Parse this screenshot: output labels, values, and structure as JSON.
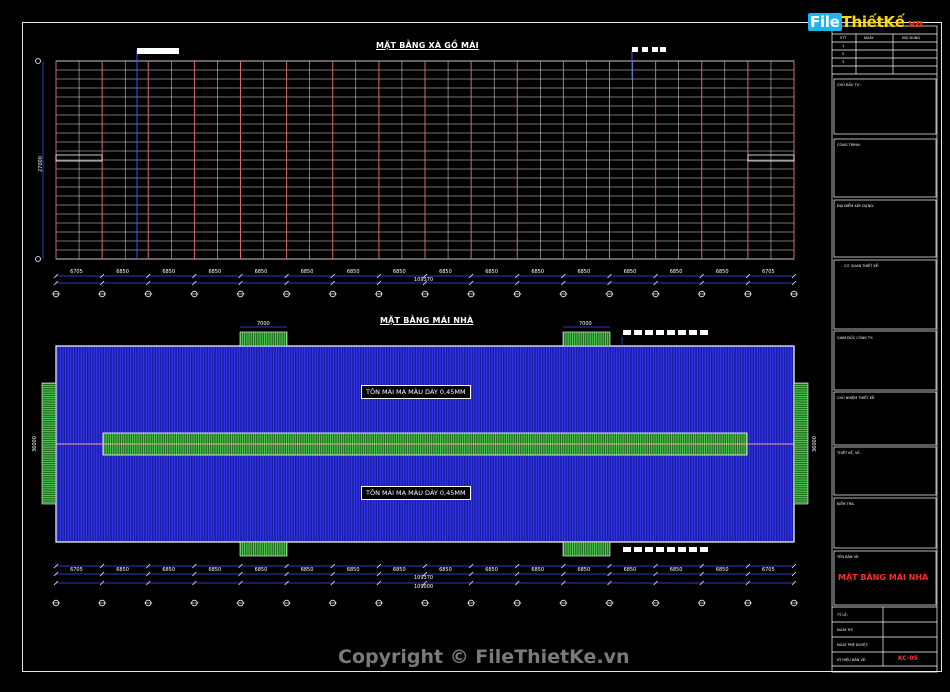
{
  "drawing": {
    "title_top": "MẶT BẰNG XÀ GỒ MÁI",
    "title_bottom": "MẶT BẰNG MÁI NHÀ",
    "roof_note_1": "TÔN MÁI MẠ MÀU DÀY 0,45MM",
    "roof_note_2": "TÔN MÁI MẠ MÀU DÀY 0,45MM",
    "top_span_labels": [
      "6705",
      "6850",
      "6850",
      "6850",
      "6850",
      "6850",
      "6850",
      "6850",
      "6850",
      "6850",
      "6850",
      "6850",
      "6850",
      "6850",
      "6850",
      "6705"
    ],
    "top_total": "109370",
    "bottom_span_labels": [
      "6705",
      "6850",
      "6850",
      "6850",
      "6850",
      "6850",
      "6850",
      "6850",
      "6850",
      "6850",
      "6850",
      "6850",
      "6850",
      "6850",
      "6850",
      "6705"
    ],
    "bottom_total_1": "109370",
    "bottom_total_2": "109000",
    "top_height_label": "27000",
    "bottom_height_left": "36000",
    "bottom_height_right": "36000",
    "skylight_dim_1": "7000",
    "skylight_dim_2": "7000"
  },
  "title_block": {
    "rows_header": [
      "STT",
      "NGÀY",
      "NỘI DUNG"
    ],
    "rows": [
      "1",
      "2",
      "3"
    ],
    "sections": [
      "CHỦ ĐẦU TƯ:",
      "CÔNG TRÌNH:",
      "ĐỊA ĐIỂM XÂY DỰNG:",
      "CƠ QUAN THIẾT KẾ:",
      "GIÁM ĐỐC CÔNG TY:",
      "CHỦ NHIỆM THIẾT KẾ:",
      "THIẾT KẾ, VẼ:",
      "KIỂM TRA:",
      "TÊN BẢN VẼ:"
    ],
    "drawing_name": "MẶT BẰNG MÁI NHÀ",
    "bottom_rows": [
      "TỶ LỆ:",
      "NGÀY HT:",
      "NGÀY PHÊ DUYỆT:",
      "KÝ HIỆU BẢN VẼ:"
    ],
    "sheet_code": "KC-05"
  },
  "watermark": {
    "logo_file": "File",
    "logo_thiet": "Thiết",
    "logo_ke": "Kế",
    "logo_vn": ".vn",
    "copyright": "Copyright © FileThietKe.vn"
  },
  "colors": {
    "background": "#000000",
    "roof_fill": "#1a1aa8",
    "skylight_green": "#2e8b2e",
    "purlin_white": "#e8e8e8",
    "rafter_red": "#d86a6a",
    "dim_blue": "#3a52ff",
    "accent_red": "#ff2a2a"
  }
}
